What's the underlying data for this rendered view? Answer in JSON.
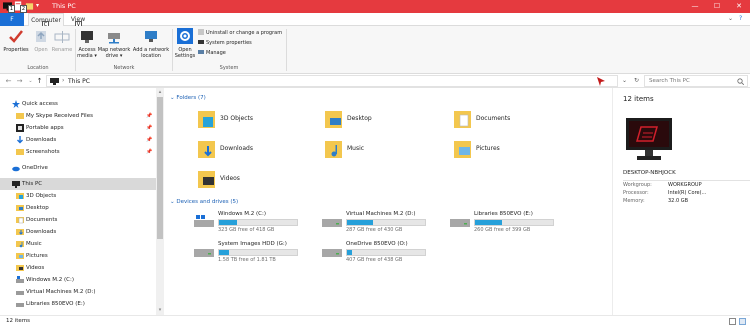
{
  "window": {
    "title": "This PC",
    "file_tab": "F",
    "tabs": [
      "Computer",
      "View"
    ],
    "keytips": {
      "computer": "C",
      "view": "V"
    },
    "accent": "#e53a3f"
  },
  "ribbon": {
    "location": {
      "label": "Location",
      "properties": "Properties",
      "open": "Open",
      "rename": "Rename"
    },
    "network": {
      "label": "Network",
      "access_media": [
        "Access",
        "media"
      ],
      "map_drive": [
        "Map network",
        "drive"
      ],
      "add_location": [
        "Add a network",
        "location"
      ]
    },
    "system": {
      "label": "System",
      "open_settings": [
        "Open",
        "Settings"
      ],
      "uninstall": "Uninstall or change a program",
      "system_properties": "System properties",
      "manage": "Manage"
    }
  },
  "address": {
    "path": "This PC",
    "search_placeholder": "Search This PC"
  },
  "sidebar": {
    "items": [
      {
        "label": "Quick access",
        "icon": "star-icon",
        "pinned": false
      },
      {
        "label": "My Skype Received Files",
        "icon": "folder-icon",
        "pinned": true
      },
      {
        "label": "Portable apps",
        "icon": "folder-icon",
        "pinned": true
      },
      {
        "label": "Downloads",
        "icon": "downloads-icon",
        "pinned": true
      },
      {
        "label": "Screenshots",
        "icon": "folder-icon",
        "pinned": true
      },
      {
        "label": "OneDrive",
        "icon": "cloud-icon",
        "pinned": false
      },
      {
        "label": "This PC",
        "icon": "pc-icon",
        "pinned": false
      },
      {
        "label": "3D Objects",
        "icon": "cube-icon",
        "pinned": false
      },
      {
        "label": "Desktop",
        "icon": "desktop-icon",
        "pinned": false
      },
      {
        "label": "Documents",
        "icon": "documents-icon",
        "pinned": false
      },
      {
        "label": "Downloads",
        "icon": "downloads-icon",
        "pinned": false
      },
      {
        "label": "Music",
        "icon": "music-icon",
        "pinned": false
      },
      {
        "label": "Pictures",
        "icon": "pictures-icon",
        "pinned": false
      },
      {
        "label": "Videos",
        "icon": "videos-icon",
        "pinned": false
      },
      {
        "label": "Windows M.2 (C:)",
        "icon": "drive-icon",
        "pinned": false
      },
      {
        "label": "Virtual Machines M.2 (D:)",
        "icon": "drive-icon",
        "pinned": false
      },
      {
        "label": "Libraries 850EVO (E:)",
        "icon": "drive-icon",
        "pinned": false
      }
    ]
  },
  "folders": {
    "header": "Folders (7)",
    "items": [
      {
        "label": "3D Objects",
        "icon": "cube-folder-icon"
      },
      {
        "label": "Desktop",
        "icon": "desktop-folder-icon"
      },
      {
        "label": "Documents",
        "icon": "documents-folder-icon"
      },
      {
        "label": "Downloads",
        "icon": "downloads-folder-icon"
      },
      {
        "label": "Music",
        "icon": "music-folder-icon"
      },
      {
        "label": "Pictures",
        "icon": "pictures-folder-icon"
      },
      {
        "label": "Videos",
        "icon": "videos-folder-icon"
      }
    ]
  },
  "drives": {
    "header": "Devices and drives (5)",
    "items": [
      {
        "name": "Windows M.2 (C:)",
        "free": "323 GB free of 418 GB",
        "used_fraction": 0.23,
        "windows": true
      },
      {
        "name": "Virtual Machines M.2 (D:)",
        "free": "287 GB free of 430 GB",
        "used_fraction": 0.33,
        "windows": false
      },
      {
        "name": "Libraries 850EVO (E:)",
        "free": "260 GB free of 399 GB",
        "used_fraction": 0.35,
        "windows": false
      },
      {
        "name": "System Images HDD (G:)",
        "free": "1.58 TB free of 1.81 TB",
        "used_fraction": 0.13,
        "windows": false
      },
      {
        "name": "OneDrive 850EVO (O:)",
        "free": "407 GB free of 438 GB",
        "used_fraction": 0.07,
        "windows": false
      }
    ],
    "bar_color": "#26a0da"
  },
  "details": {
    "count": "12 items",
    "pc_name": "DESKTOP-NBHJOCK",
    "props": [
      {
        "k": "Workgroup:",
        "v": "WORKGROUP"
      },
      {
        "k": "Processor:",
        "v": "Intel(R) Core(..."
      },
      {
        "k": "Memory:",
        "v": "32.0 GB"
      }
    ]
  },
  "status": {
    "text": "12 items"
  }
}
